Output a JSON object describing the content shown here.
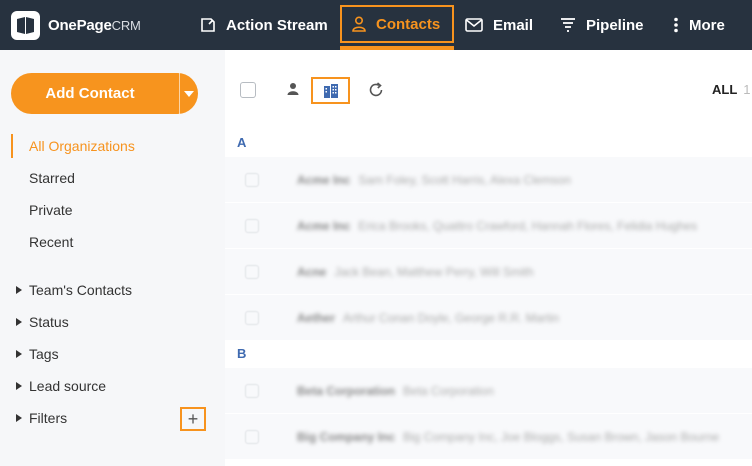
{
  "app": {
    "logo_text": "OnePage",
    "logo_suffix": "CRM"
  },
  "nav": {
    "items": [
      {
        "label": "Action Stream",
        "icon": "action-stream-icon"
      },
      {
        "label": "Contacts",
        "icon": "person-icon",
        "active": true
      },
      {
        "label": "Email",
        "icon": "envelope-icon"
      },
      {
        "label": "Pipeline",
        "icon": "funnel-icon"
      },
      {
        "label": "More",
        "icon": "kebab-icon"
      }
    ]
  },
  "sidebar": {
    "add_contact_label": "Add Contact",
    "links": [
      {
        "label": "All Organizations",
        "active": true
      },
      {
        "label": "Starred"
      },
      {
        "label": "Private"
      },
      {
        "label": "Recent"
      }
    ],
    "groups": [
      {
        "label": "Team's Contacts"
      },
      {
        "label": "Status"
      },
      {
        "label": "Tags"
      },
      {
        "label": "Lead source"
      },
      {
        "label": "Filters"
      }
    ],
    "filters_add_symbol": "+"
  },
  "toolbar": {
    "all_label": "ALL",
    "all_count": "1"
  },
  "list": {
    "sections": [
      {
        "letter": "A",
        "rows": [
          {
            "name": "Acme Inc",
            "people": "Sam Foley, Scott Harris, Alexa Clemson"
          },
          {
            "name": "Acme Inc",
            "people": "Erica Brooks, Quattro Crawford, Hannah Flores, Felidia Hughes"
          },
          {
            "name": "Acne",
            "people": "Jack Bean, Matthew Perry, Will Smith"
          },
          {
            "name": "Aether",
            "people": "Arthur Conan Doyle, George R.R. Martin"
          }
        ]
      },
      {
        "letter": "B",
        "rows": [
          {
            "name": "Beta Corporation",
            "people": "Beta Corporation"
          },
          {
            "name": "Big Company Inc",
            "people": "Big Company Inc, Joe Bloggs, Susan Brown, Jason Bourne"
          }
        ]
      }
    ]
  },
  "colors": {
    "topbar": "#27323f",
    "accent": "#f7931e",
    "section_letter": "#3f6ab0"
  }
}
